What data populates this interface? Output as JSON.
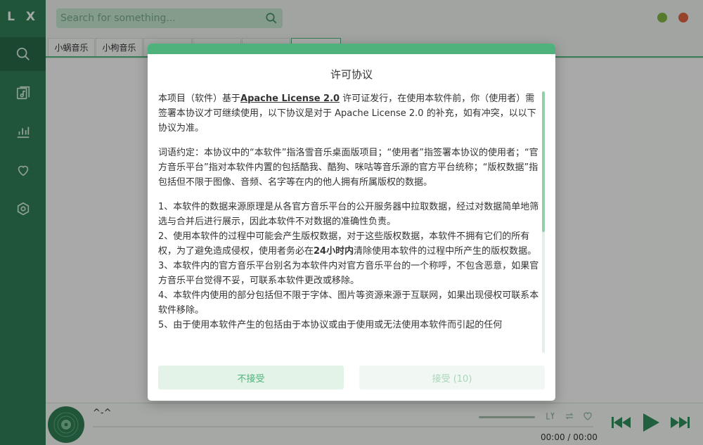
{
  "app": {
    "logo": "L X"
  },
  "sidebar": {
    "items": [
      {
        "name": "search",
        "icon": "search-icon",
        "active": true
      },
      {
        "name": "songlist",
        "icon": "music-list-icon",
        "active": false
      },
      {
        "name": "leaderboard",
        "icon": "bar-chart-icon",
        "active": false
      },
      {
        "name": "favorites",
        "icon": "heart-icon",
        "active": false
      },
      {
        "name": "settings",
        "icon": "settings-icon",
        "active": false
      }
    ]
  },
  "search": {
    "placeholder": "Search for something..."
  },
  "tabs": [
    {
      "label": "小蜗音乐"
    },
    {
      "label": "小枸音乐"
    },
    {
      "label": ""
    },
    {
      "label": ""
    },
    {
      "label": ""
    },
    {
      "label": ""
    }
  ],
  "player": {
    "title": "^-^",
    "time_current": "00:00",
    "time_separator": "/",
    "time_total": "00:00"
  },
  "modal": {
    "title": "许可协议",
    "p1_a": "本项目（软件）基于",
    "p1_link": "Apache License 2.0",
    "p1_b": " 许可证发行，在使用本软件前，你（使用者）需签署本协议才可继续使用，以下协议是对于 Apache License 2.0 的补充，如有冲突，以以下协议为准。",
    "p2": "词语约定：本协议中的“本软件”指洛雪音乐桌面版项目；“使用者”指签署本协议的使用者；“官方音乐平台”指对本软件内置的包括酷我、酷狗、咪咕等音乐源的官方平台统称；“版权数据”指包括但不限于图像、音频、名字等在内的他人拥有所属版权的数据。",
    "item1": "1、本软件的数据来源原理是从各官方音乐平台的公开服务器中拉取数据，经过对数据简单地筛选与合并后进行展示，因此本软件不对数据的准确性负责。",
    "item2_a": "2、使用本软件的过程中可能会产生版权数据，对于这些版权数据，本软件不拥有它们的所有权，为了避免造成侵权，使用者务必在",
    "item2_bold": "24小时内",
    "item2_b": "清除使用本软件的过程中所产生的版权数据。",
    "item3": "3、本软件内的官方音乐平台别名为本软件内对官方音乐平台的一个称呼，不包含恶意，如果官方音乐平台觉得不妥，可联系本软件更改或移除。",
    "item4": "4、本软件内使用的部分包括但不限于字体、图片等资源来源于互联网，如果出现侵权可联系本软件移除。",
    "item5": "5、由于使用本软件产生的包括由于本协议或由于使用或无法使用本软件而引起的任何",
    "reject_label": "不接受",
    "accept_label": "接受 (10)"
  },
  "colors": {
    "sidebar": "#2f7a52",
    "accent": "#4fb27c",
    "minimize": "#7bb041",
    "close": "#d9603e"
  }
}
